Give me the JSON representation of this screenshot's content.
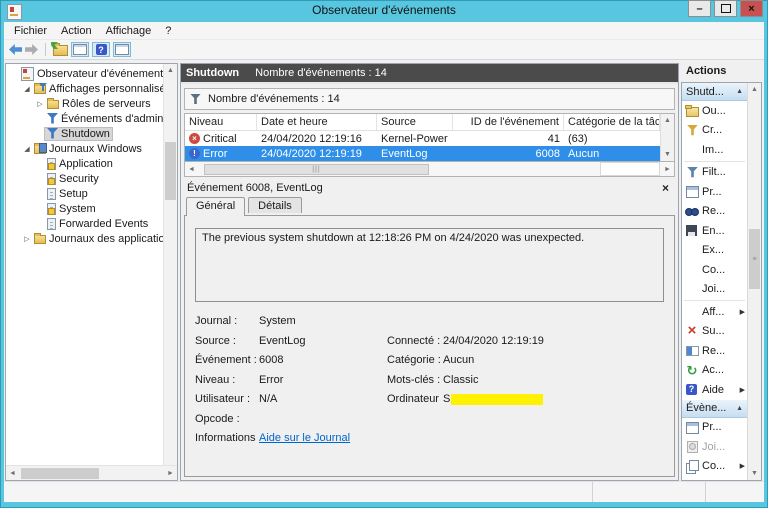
{
  "window": {
    "title": "Observateur d'événements"
  },
  "menubar": {
    "items": [
      "Fichier",
      "Action",
      "Affichage",
      "?"
    ]
  },
  "toolbar": {
    "icons": [
      "back-arrow",
      "forward-arrow",
      "folder-export",
      "show-console-tree",
      "help",
      "show-action-pane"
    ]
  },
  "tree": {
    "items": [
      {
        "label": "Observateur d'événements (SCC",
        "depth": 0,
        "icon": "console",
        "expander": "",
        "selected": false
      },
      {
        "label": "Affichages personnalisés",
        "depth": 1,
        "icon": "folder-filter",
        "expander": "expanded",
        "selected": false
      },
      {
        "label": "Rôles de serveurs",
        "depth": 2,
        "icon": "folder",
        "expander": "collapsed",
        "selected": false
      },
      {
        "label": "Événements d'administra",
        "depth": 2,
        "icon": "filter",
        "expander": "",
        "selected": false
      },
      {
        "label": "Shutdown",
        "depth": 2,
        "icon": "filter",
        "expander": "",
        "selected": true
      },
      {
        "label": "Journaux Windows",
        "depth": 1,
        "icon": "folder-log",
        "expander": "expanded",
        "selected": false
      },
      {
        "label": "Application",
        "depth": 2,
        "icon": "log-marked",
        "expander": "",
        "selected": false
      },
      {
        "label": "Security",
        "depth": 2,
        "icon": "log-marked",
        "expander": "",
        "selected": false
      },
      {
        "label": "Setup",
        "depth": 2,
        "icon": "log",
        "expander": "",
        "selected": false
      },
      {
        "label": "System",
        "depth": 2,
        "icon": "log-marked",
        "expander": "",
        "selected": false
      },
      {
        "label": "Forwarded Events",
        "depth": 2,
        "icon": "log",
        "expander": "",
        "selected": false
      },
      {
        "label": "Journaux des applications et",
        "depth": 1,
        "icon": "folder",
        "expander": "collapsed",
        "selected": false
      }
    ]
  },
  "list": {
    "view_title": "Shutdown",
    "count_label": "Nombre d'événements : 14",
    "filter_count_label": "Nombre d'événements : 14",
    "columns": [
      "Niveau",
      "Date et heure",
      "Source",
      "ID de l'événement",
      "Catégorie de la tâche"
    ],
    "rows": [
      {
        "level": "Critical",
        "level_icon": "critical",
        "date": "24/04/2020 12:19:16",
        "source": "Kernel-Power",
        "event_id": "41",
        "task_category": "(63)",
        "selected": false
      },
      {
        "level": "Error",
        "level_icon": "error",
        "date": "24/04/2020 12:19:19",
        "source": "EventLog",
        "event_id": "6008",
        "task_category": "Aucun",
        "selected": true
      }
    ]
  },
  "details": {
    "title": "Événement 6008, EventLog",
    "tabs": [
      {
        "label": "Général",
        "active": true
      },
      {
        "label": "Détails",
        "active": false
      }
    ],
    "message": "The previous system shutdown at 12:18:26 PM on 4/24/2020 was unexpected.",
    "fields": [
      {
        "label": "Journal :",
        "value": "System"
      },
      {
        "label": "Source :",
        "value": "EventLog",
        "label2": "Connecté :",
        "value2": "24/04/2020 12:19:19"
      },
      {
        "label": "Événement :",
        "value": "6008",
        "label2": "Catégorie :",
        "value2": "Aucun"
      },
      {
        "label": "Niveau :",
        "value": "Error",
        "label2": "Mots-clés :",
        "value2": "Classic"
      },
      {
        "label": "Utilisateur :",
        "value": "N/A",
        "label2": "Ordinateur :",
        "value2": "S",
        "redacted": true
      },
      {
        "label": "Opcode :",
        "value": ""
      },
      {
        "label": "Informations :",
        "value": "Aide sur le Journal",
        "link": true
      }
    ]
  },
  "actions": {
    "title": "Actions",
    "groups": [
      {
        "header": "Shutd...",
        "items": [
          {
            "label": "Ou...",
            "icon": "open-folder"
          },
          {
            "label": "Cr...",
            "icon": "create-filter"
          },
          {
            "label": "Im...",
            "icon": "none",
            "divider_after": true
          },
          {
            "label": "Filt...",
            "icon": "filter"
          },
          {
            "label": "Pr...",
            "icon": "properties"
          },
          {
            "label": "Re...",
            "icon": "find"
          },
          {
            "label": "En...",
            "icon": "save"
          },
          {
            "label": "Ex...",
            "icon": "none"
          },
          {
            "label": "Co...",
            "icon": "none"
          },
          {
            "label": "Joi...",
            "icon": "none",
            "divider_after": true
          },
          {
            "label": "Aff...",
            "icon": "none",
            "submenu": true
          },
          {
            "label": "Su...",
            "icon": "delete"
          },
          {
            "label": "Re...",
            "icon": "rename"
          },
          {
            "label": "Ac...",
            "icon": "refresh"
          },
          {
            "label": "Aide",
            "icon": "help",
            "submenu": true
          }
        ]
      },
      {
        "header": "Évène...",
        "items": [
          {
            "label": "Pr...",
            "icon": "properties"
          },
          {
            "label": "Joi...",
            "icon": "task",
            "disabled": true
          },
          {
            "label": "Co...",
            "icon": "copy",
            "submenu": true
          }
        ]
      }
    ]
  },
  "colors": {
    "titlebar": "#58C6DF",
    "close_button": "#C75050",
    "selection_blue": "#2F8FE8",
    "dark_header": "#4B4B4B",
    "link": "#0066CC",
    "redaction_yellow": "#FFF200",
    "critical_icon": "#CE4A41",
    "error_icon": "#3D66C9"
  }
}
